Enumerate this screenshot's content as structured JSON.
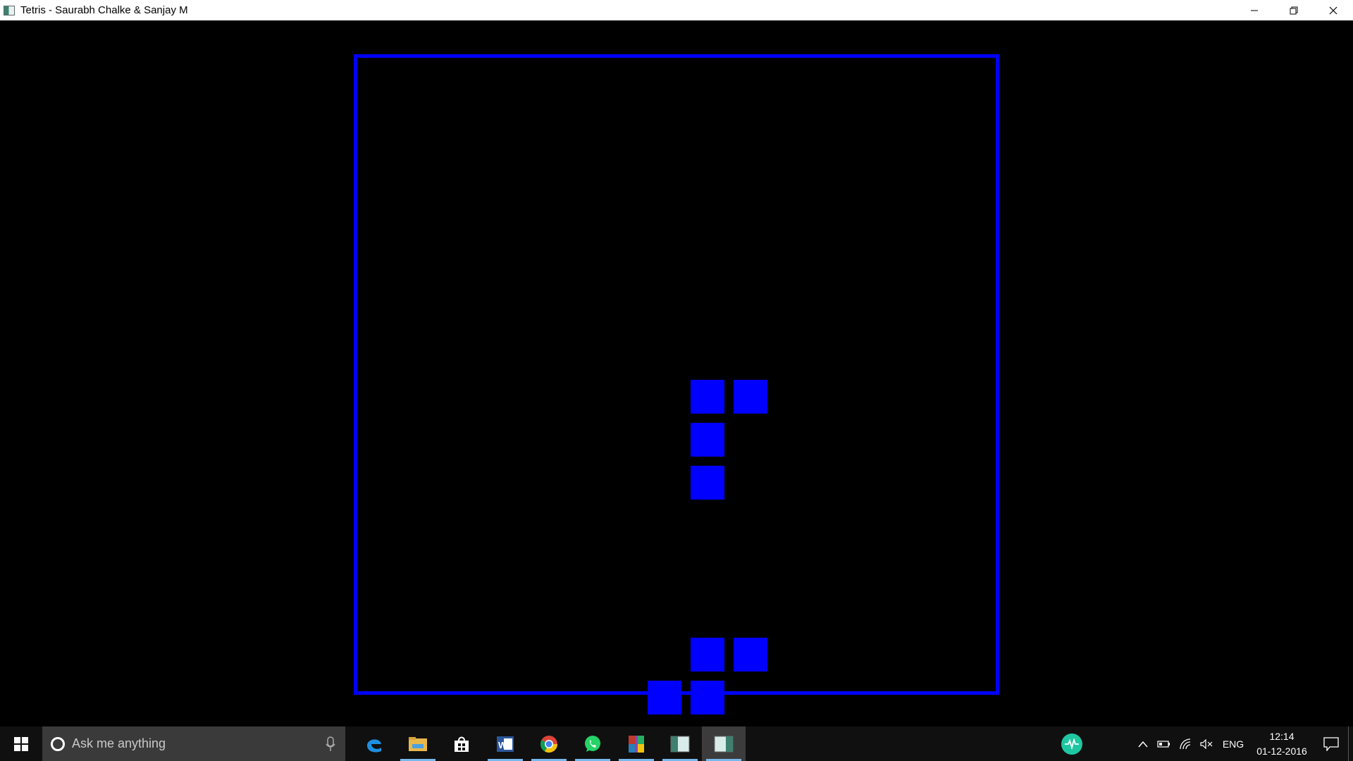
{
  "window": {
    "title": "Tetris - Saurabh Chalke & Sanjay M",
    "controls": [
      "minimize",
      "restore",
      "close"
    ]
  },
  "game": {
    "border_color": "#0000ff",
    "block_color": "#0000ff",
    "background": "#000000",
    "blocks": [
      {
        "col": 7,
        "row": 7
      },
      {
        "col": 8,
        "row": 7
      },
      {
        "col": 7,
        "row": 8
      },
      {
        "col": 7,
        "row": 9
      },
      {
        "col": 7,
        "row": 13
      },
      {
        "col": 8,
        "row": 13
      },
      {
        "col": 6,
        "row": 14
      },
      {
        "col": 7,
        "row": 14
      }
    ]
  },
  "taskbar": {
    "search_placeholder": "Ask me anything",
    "apps": [
      {
        "name": "edge-icon",
        "open": false
      },
      {
        "name": "file-explorer-icon",
        "open": true
      },
      {
        "name": "store-icon",
        "open": false
      },
      {
        "name": "word-icon",
        "open": true
      },
      {
        "name": "chrome-icon",
        "open": true
      },
      {
        "name": "whatsapp-icon",
        "open": true
      },
      {
        "name": "winrar-icon",
        "open": true
      },
      {
        "name": "tetris-app-icon",
        "open": true
      },
      {
        "name": "tetris-app-icon-2",
        "open": true,
        "active": true
      }
    ],
    "tray": {
      "language": "ENG",
      "time": "12:14",
      "date": "01-12-2016"
    }
  }
}
